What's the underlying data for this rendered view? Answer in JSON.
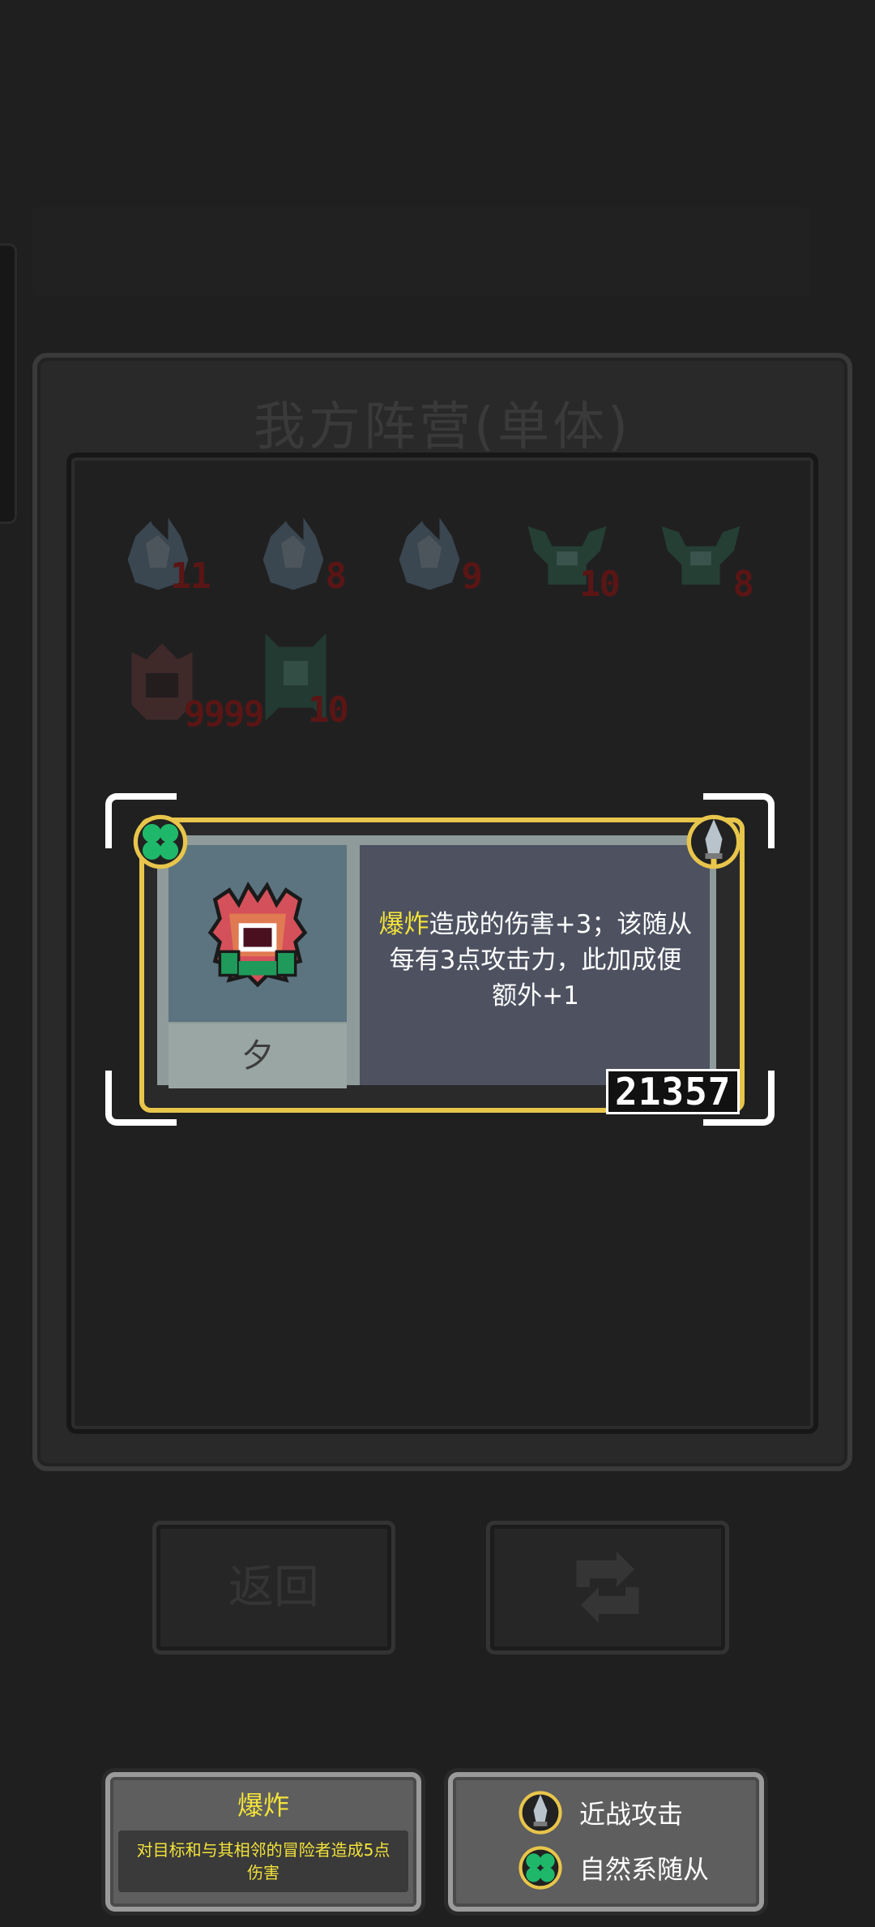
{
  "panel": {
    "title": "我方阵营(单体)"
  },
  "units": [
    {
      "type": "flame-spirit",
      "count": "11"
    },
    {
      "type": "flame-spirit",
      "count": "8"
    },
    {
      "type": "flame-spirit",
      "count": "9"
    },
    {
      "type": "green-crab",
      "count": "10"
    },
    {
      "type": "green-crab",
      "count": "8"
    },
    {
      "type": "plant-monster",
      "count": "9999"
    },
    {
      "type": "totem-guardian",
      "count": "10"
    }
  ],
  "card": {
    "name": "夕",
    "desc_keyword": "爆炸",
    "desc_line1_rest": "造成的伤害+3；该随从",
    "desc_line2": "每有3点攻击力，此加成便",
    "desc_line3": "额外+1",
    "score": "21357",
    "corner_left_icon": "clover-icon",
    "corner_right_icon": "dagger-icon"
  },
  "buttons": {
    "back_label": "返回",
    "refresh_icon": "refresh-icon"
  },
  "keyword_info": {
    "title": "爆炸",
    "description": "对目标和与其相邻的冒险者造成5点伤害"
  },
  "traits": [
    {
      "icon": "dagger-icon",
      "label": "近战攻击"
    },
    {
      "icon": "clover-icon",
      "label": "自然系随从"
    }
  ],
  "colors": {
    "accent_yellow": "#f2e33a",
    "card_border": "#e8c54b",
    "clover_green": "#1fb86b"
  }
}
